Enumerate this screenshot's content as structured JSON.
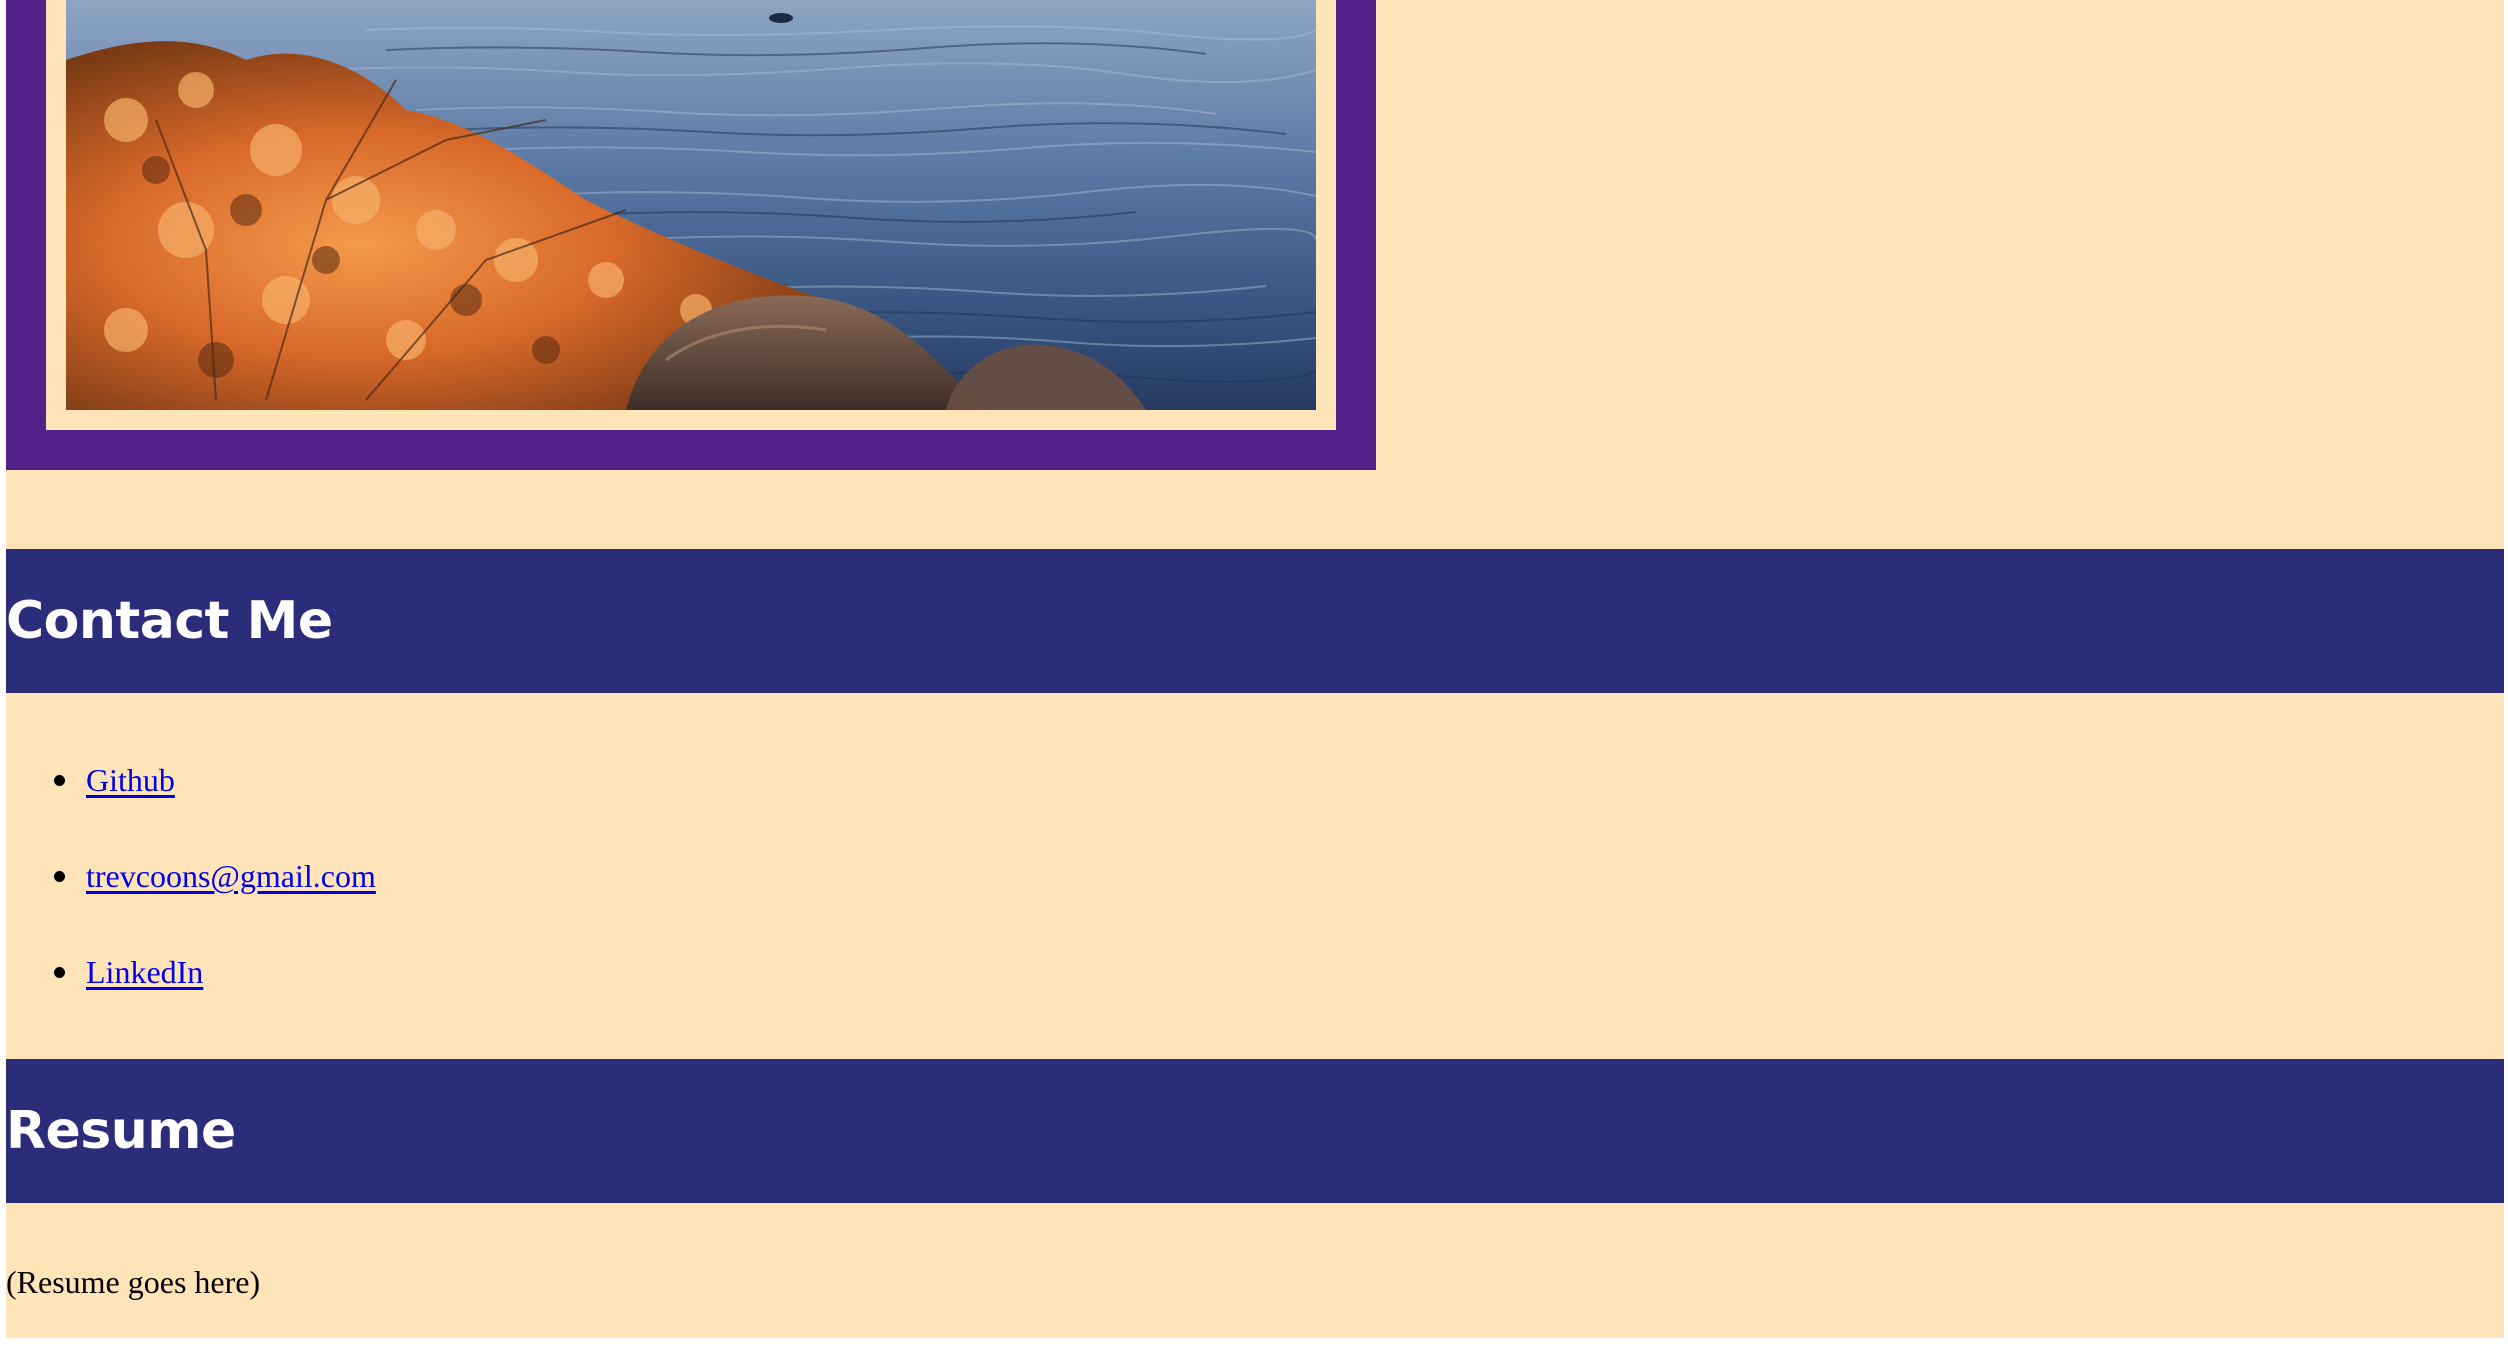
{
  "theme": {
    "page_bg": "#ffe4b8",
    "frame_color": "#54208a",
    "header_bg": "#2c2d7a",
    "header_text": "#ffffff",
    "link_color": "#0000ee"
  },
  "photo": {
    "subject": "lake-with-autumn-shrubs-photo"
  },
  "contact": {
    "heading": "Contact Me",
    "links": [
      {
        "label": "Github"
      },
      {
        "label": "trevcoons@gmail.com"
      },
      {
        "label": "LinkedIn"
      }
    ]
  },
  "resume": {
    "heading": "Resume",
    "body": "(Resume goes here)"
  }
}
